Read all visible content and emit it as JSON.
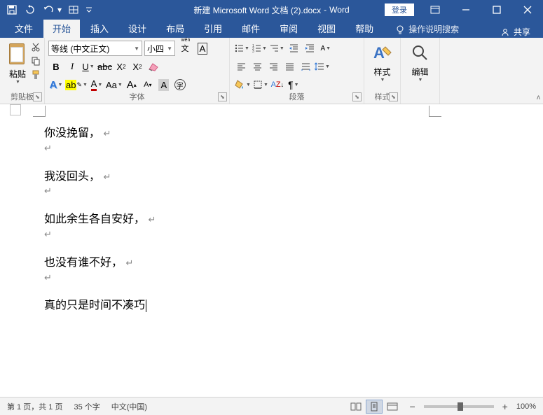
{
  "title": {
    "doc": "新建 Microsoft Word 文档 (2).docx",
    "app": "Word",
    "login": "登录"
  },
  "tabs": {
    "file": "文件",
    "home": "开始",
    "insert": "插入",
    "design": "设计",
    "layout": "布局",
    "ref": "引用",
    "mail": "邮件",
    "review": "审阅",
    "view": "视图",
    "help": "帮助",
    "tellme": "操作说明搜索",
    "share": "共享"
  },
  "ribbon": {
    "clipboard": {
      "paste": "粘贴",
      "label": "剪贴板"
    },
    "font": {
      "name": "等线 (中文正文)",
      "size": "小四",
      "label": "字体"
    },
    "paragraph": {
      "label": "段落"
    },
    "styles": {
      "label": "样式",
      "btn": "样式"
    },
    "editing": {
      "label": "",
      "btn": "编辑"
    }
  },
  "document": {
    "lines": [
      "你没挽留，",
      "",
      "我没回头，",
      "",
      "如此余生各自安好，",
      "",
      "也没有谁不好，",
      "",
      "真的只是时间不凑巧"
    ]
  },
  "status": {
    "page": "第 1 页，共 1 页",
    "words": "35 个字",
    "lang": "中文(中国)",
    "zoom": "100%"
  }
}
